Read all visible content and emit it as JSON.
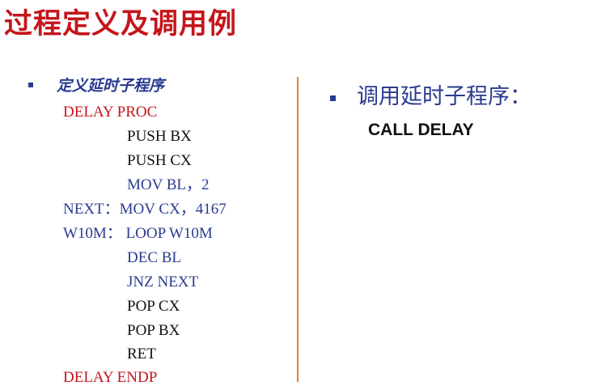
{
  "page": {
    "title": "过程定义及调用例"
  },
  "left": {
    "heading": "定义延时子程序",
    "code": [
      {
        "text": "DELAY  PROC",
        "color": "red"
      },
      {
        "text": "PUSH BX",
        "color": "black"
      },
      {
        "text": "PUSH CX",
        "color": "black"
      },
      {
        "text": "MOV  BL，2",
        "color": "blue"
      },
      {
        "text": "NEXT：MOV  CX，4167",
        "color": "blue"
      },
      {
        "text": "W10M：  LOOP  W10M",
        "color": "blue"
      },
      {
        "text": "DEC  BL",
        "color": "blue"
      },
      {
        "text": "JNZ  NEXT",
        "color": "blue"
      },
      {
        "text": "POP  CX",
        "color": "black"
      },
      {
        "text": "POP  BX",
        "color": "black"
      },
      {
        "text": "RET",
        "color": "black"
      },
      {
        "text": "DELAY  ENDP",
        "color": "red"
      }
    ]
  },
  "right": {
    "heading": "调用延时子程序：",
    "call": "CALL  DELAY"
  },
  "colors": {
    "title": "#c4161c",
    "accent_blue": "#2a3b8f",
    "divider": "#e4822f"
  }
}
